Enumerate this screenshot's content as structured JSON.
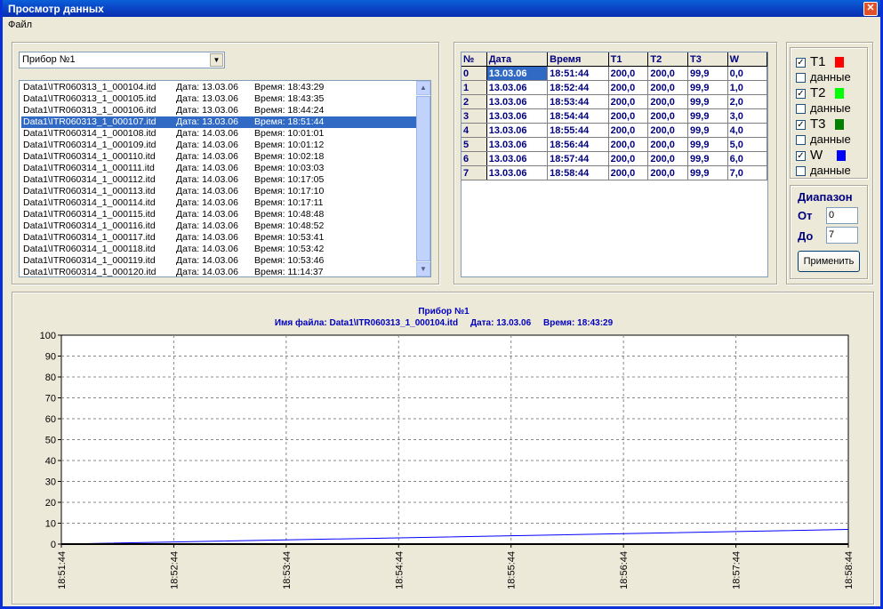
{
  "window": {
    "title": "Просмотр данных",
    "close_glyph": "✕"
  },
  "menu": {
    "items": [
      "Файл"
    ]
  },
  "device_select": {
    "value": "Прибор №1"
  },
  "files": [
    {
      "name": "Data1\\ITR060313_1_000104.itd",
      "date": "Дата: 13.03.06",
      "time": "Время: 18:43:29"
    },
    {
      "name": "Data1\\ITR060313_1_000105.itd",
      "date": "Дата: 13.03.06",
      "time": "Время: 18:43:35"
    },
    {
      "name": "Data1\\ITR060313_1_000106.itd",
      "date": "Дата: 13.03.06",
      "time": "Время: 18:44:24"
    },
    {
      "name": "Data1\\ITR060313_1_000107.itd",
      "date": "Дата: 13.03.06",
      "time": "Время: 18:51:44",
      "selected": true
    },
    {
      "name": "Data1\\ITR060314_1_000108.itd",
      "date": "Дата: 14.03.06",
      "time": "Время: 10:01:01"
    },
    {
      "name": "Data1\\ITR060314_1_000109.itd",
      "date": "Дата: 14.03.06",
      "time": "Время: 10:01:12"
    },
    {
      "name": "Data1\\ITR060314_1_000110.itd",
      "date": "Дата: 14.03.06",
      "time": "Время: 10:02:18"
    },
    {
      "name": "Data1\\ITR060314_1_000111.itd",
      "date": "Дата: 14.03.06",
      "time": "Время: 10:03:03"
    },
    {
      "name": "Data1\\ITR060314_1_000112.itd",
      "date": "Дата: 14.03.06",
      "time": "Время: 10:17:05"
    },
    {
      "name": "Data1\\ITR060314_1_000113.itd",
      "date": "Дата: 14.03.06",
      "time": "Время: 10:17:10"
    },
    {
      "name": "Data1\\ITR060314_1_000114.itd",
      "date": "Дата: 14.03.06",
      "time": "Время: 10:17:11"
    },
    {
      "name": "Data1\\ITR060314_1_000115.itd",
      "date": "Дата: 14.03.06",
      "time": "Время: 10:48:48"
    },
    {
      "name": "Data1\\ITR060314_1_000116.itd",
      "date": "Дата: 14.03.06",
      "time": "Время: 10:48:52"
    },
    {
      "name": "Data1\\ITR060314_1_000117.itd",
      "date": "Дата: 14.03.06",
      "time": "Время: 10:53:41"
    },
    {
      "name": "Data1\\ITR060314_1_000118.itd",
      "date": "Дата: 14.03.06",
      "time": "Время: 10:53:42"
    },
    {
      "name": "Data1\\ITR060314_1_000119.itd",
      "date": "Дата: 14.03.06",
      "time": "Время: 10:53:46"
    },
    {
      "name": "Data1\\ITR060314_1_000120.itd",
      "date": "Дата: 14.03.06",
      "time": "Время: 11:14:37"
    }
  ],
  "table": {
    "headers": [
      "№",
      "Дата",
      "Время",
      "T1",
      "T2",
      "T3",
      "W"
    ],
    "rows": [
      [
        "0",
        "13.03.06",
        "18:51:44",
        "200,0",
        "200,0",
        "99,9",
        "0,0"
      ],
      [
        "1",
        "13.03.06",
        "18:52:44",
        "200,0",
        "200,0",
        "99,9",
        "1,0"
      ],
      [
        "2",
        "13.03.06",
        "18:53:44",
        "200,0",
        "200,0",
        "99,9",
        "2,0"
      ],
      [
        "3",
        "13.03.06",
        "18:54:44",
        "200,0",
        "200,0",
        "99,9",
        "3,0"
      ],
      [
        "4",
        "13.03.06",
        "18:55:44",
        "200,0",
        "200,0",
        "99,9",
        "4,0"
      ],
      [
        "5",
        "13.03.06",
        "18:56:44",
        "200,0",
        "200,0",
        "99,9",
        "5,0"
      ],
      [
        "6",
        "13.03.06",
        "18:57:44",
        "200,0",
        "200,0",
        "99,9",
        "6,0"
      ],
      [
        "7",
        "13.03.06",
        "18:58:44",
        "200,0",
        "200,0",
        "99,9",
        "7,0"
      ]
    ]
  },
  "legend": [
    {
      "label": "T1",
      "checked": true,
      "color": "#ff0000",
      "data_label": "данные",
      "data_checked": false
    },
    {
      "label": "T2",
      "checked": true,
      "color": "#00ff00",
      "data_label": "данные",
      "data_checked": false
    },
    {
      "label": "T3",
      "checked": true,
      "color": "#008000",
      "data_label": "данные",
      "data_checked": false
    },
    {
      "label": "W",
      "checked": true,
      "color": "#0000ff",
      "data_label": "данные",
      "data_checked": false
    }
  ],
  "range": {
    "title": "Диапазон",
    "from_label": "От",
    "from_value": "0",
    "to_label": "До",
    "to_value": "7",
    "apply_label": "Применить"
  },
  "chart_data": {
    "type": "line",
    "title": "Прибор №1",
    "subtitle": "Имя файла: Data1\\ITR060313_1_000104.itd     Дата: 13.03.06     Время: 18:43:29",
    "categories": [
      "18:51:44",
      "18:52:44",
      "18:53:44",
      "18:54:44",
      "18:55:44",
      "18:56:44",
      "18:57:44",
      "18:58:44"
    ],
    "yticks": [
      0,
      10,
      20,
      30,
      40,
      50,
      60,
      70,
      80,
      90,
      100
    ],
    "ylim": [
      0,
      100
    ],
    "grid": true,
    "series": [
      {
        "color": "#0000ff",
        "values": [
          0,
          1,
          2,
          3,
          4,
          5,
          6,
          7
        ]
      }
    ]
  }
}
